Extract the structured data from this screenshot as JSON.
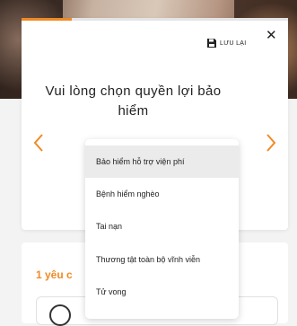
{
  "modal": {
    "save_label": "LƯU LẠI",
    "close_label": "✕",
    "prompt": "Vui lòng chọn quyền lợi bảo hiểm"
  },
  "dropdown": {
    "items": [
      {
        "label": "Bảo hiểm hỗ trợ viện phí"
      },
      {
        "label": "Bệnh hiểm nghèo"
      },
      {
        "label": "Tai nạn"
      },
      {
        "label": "Thương tật toàn bộ vĩnh viễn"
      },
      {
        "label": "Tử vong"
      }
    ]
  },
  "background": {
    "request_count": "1 yêu c"
  },
  "colors": {
    "accent": "#f08a24",
    "selected_item_bg": "#ebebeb"
  }
}
